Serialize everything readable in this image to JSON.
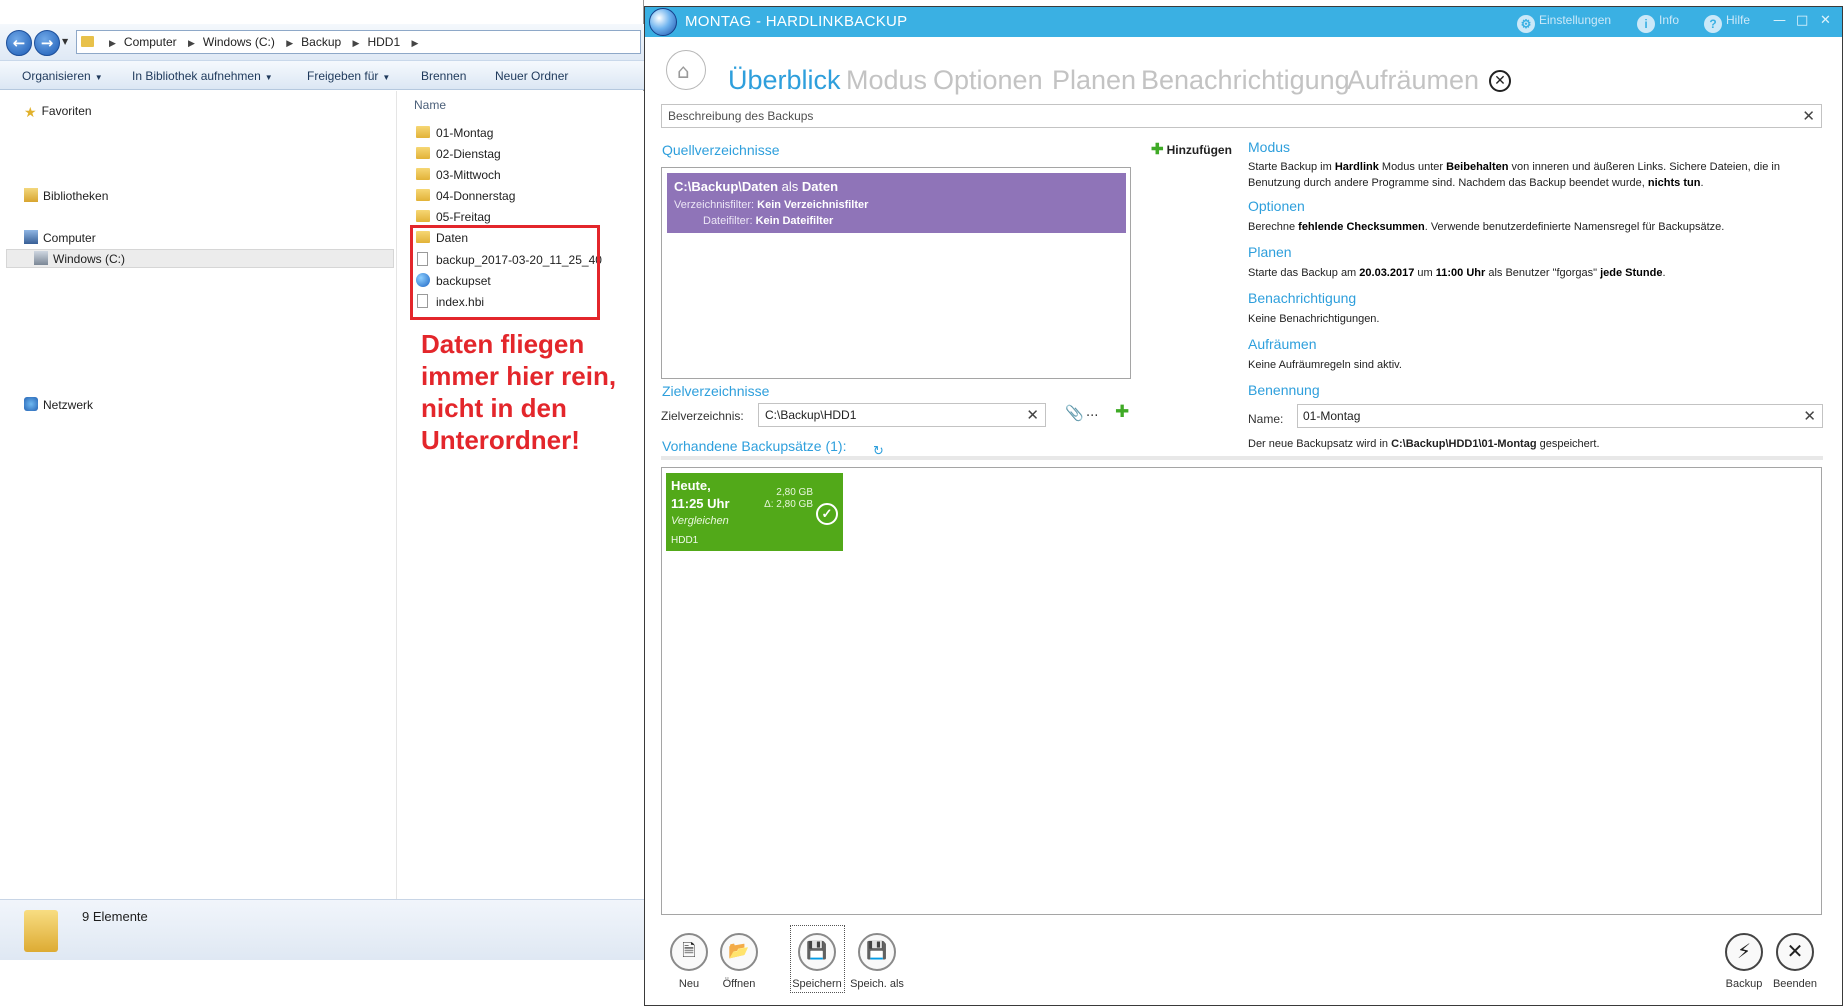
{
  "explorer": {
    "breadcrumb": [
      "Computer",
      "Windows (C:)",
      "Backup",
      "HDD1"
    ],
    "toolbar": [
      "Organisieren",
      "In Bibliothek aufnehmen",
      "Freigeben für",
      "Brennen",
      "Neuer Ordner"
    ],
    "nav": {
      "favorites": "Favoriten",
      "libraries": "Bibliotheken",
      "computer": "Computer",
      "drive": "Windows (C:)",
      "network": "Netzwerk"
    },
    "column_name": "Name",
    "files": [
      "01-Montag",
      "02-Dienstag",
      "03-Mittwoch",
      "04-Donnerstag",
      "05-Freitag",
      "Daten",
      "backup_2017-03-20_11_25_40",
      "backupset",
      "index.hbi"
    ],
    "annotation": "Daten fliegen immer hier rein, nicht in den Unterordner!",
    "status": "9 Elemente"
  },
  "app": {
    "title": "MONTAG - HARDLINKBACKUP",
    "titlebar_buttons": [
      "Einstellungen",
      "Info",
      "Hilfe"
    ],
    "tabs": [
      "Überblick",
      "Modus",
      "Optionen",
      "Planen",
      "Benachrichtigung",
      "Aufräumen"
    ],
    "description_placeholder": "Beschreibung des Backups",
    "sources_title": "Quellverzeichnisse",
    "add_label": "Hinzufügen",
    "source": {
      "path": "C:\\Backup\\Daten",
      "as_word": "als",
      "alias": "Daten",
      "dir_filter_label": "Verzeichnisfilter:",
      "dir_filter_value": "Kein Verzeichnisfilter",
      "file_filter_label": "Dateifilter:",
      "file_filter_value": "Kein Dateifilter"
    },
    "targets_title": "Zielverzeichnisse",
    "target_label": "Zielverzeichnis:",
    "target_value": "C:\\Backup\\HDD1",
    "browse_label": "...",
    "sets_title": "Vorhandene Backupsätze (1):",
    "summary": {
      "modus_title": "Modus",
      "modus_text": {
        "p1": "Starte Backup im ",
        "b1": "Hardlink",
        "p2": " Modus unter ",
        "b2": "Beibehalten",
        "p3": " von inneren und äußeren Links. Sichere Dateien, die in Benutzung durch andere Programme sind. Nachdem das Backup beendet wurde, ",
        "b3": "nichts tun",
        "p4": "."
      },
      "optionen_title": "Optionen",
      "optionen_text": {
        "p1": "Berechne ",
        "b1": "fehlende Checksummen",
        "p2": ". Verwende benutzerdefinierte Namensregel für Backupsätze."
      },
      "planen_title": "Planen",
      "planen_text": {
        "p1": "Starte das Backup am ",
        "b1": "20.03.2017",
        "p2": " um ",
        "b2": "11:00 Uhr",
        "p3": " als Benutzer \"fgorgas\" ",
        "b3": "jede Stunde",
        "p4": "."
      },
      "benachrichtigung_title": "Benachrichtigung",
      "benachrichtigung_text": "Keine Benachrichtigungen.",
      "aufraeumen_title": "Aufräumen",
      "aufraeumen_text": "Keine Aufräumregeln sind aktiv.",
      "benennung_title": "Benennung"
    },
    "name_label": "Name:",
    "name_value": "01-Montag",
    "save_note": {
      "p1": "Der neue Backupsatz wird in ",
      "b1": "C:\\Backup\\HDD1\\01-Montag",
      "p2": " gespeichert."
    },
    "backup_set": {
      "day": "Heute,",
      "time": "11:25 Uhr",
      "size": "2,80 GB",
      "delta": "Δ: 2,80 GB",
      "action": "Vergleichen",
      "disk": "HDD1"
    },
    "bottom_buttons": [
      "Neu",
      "Öffnen",
      "Speichern",
      "Speich. als",
      "Backup",
      "Beenden"
    ],
    "colors": {
      "accent": "#2e9fdc",
      "titlebar": "#3ab0e3",
      "source": "#8f74b8",
      "tile": "#52a919",
      "annotation": "#e3262b"
    }
  }
}
